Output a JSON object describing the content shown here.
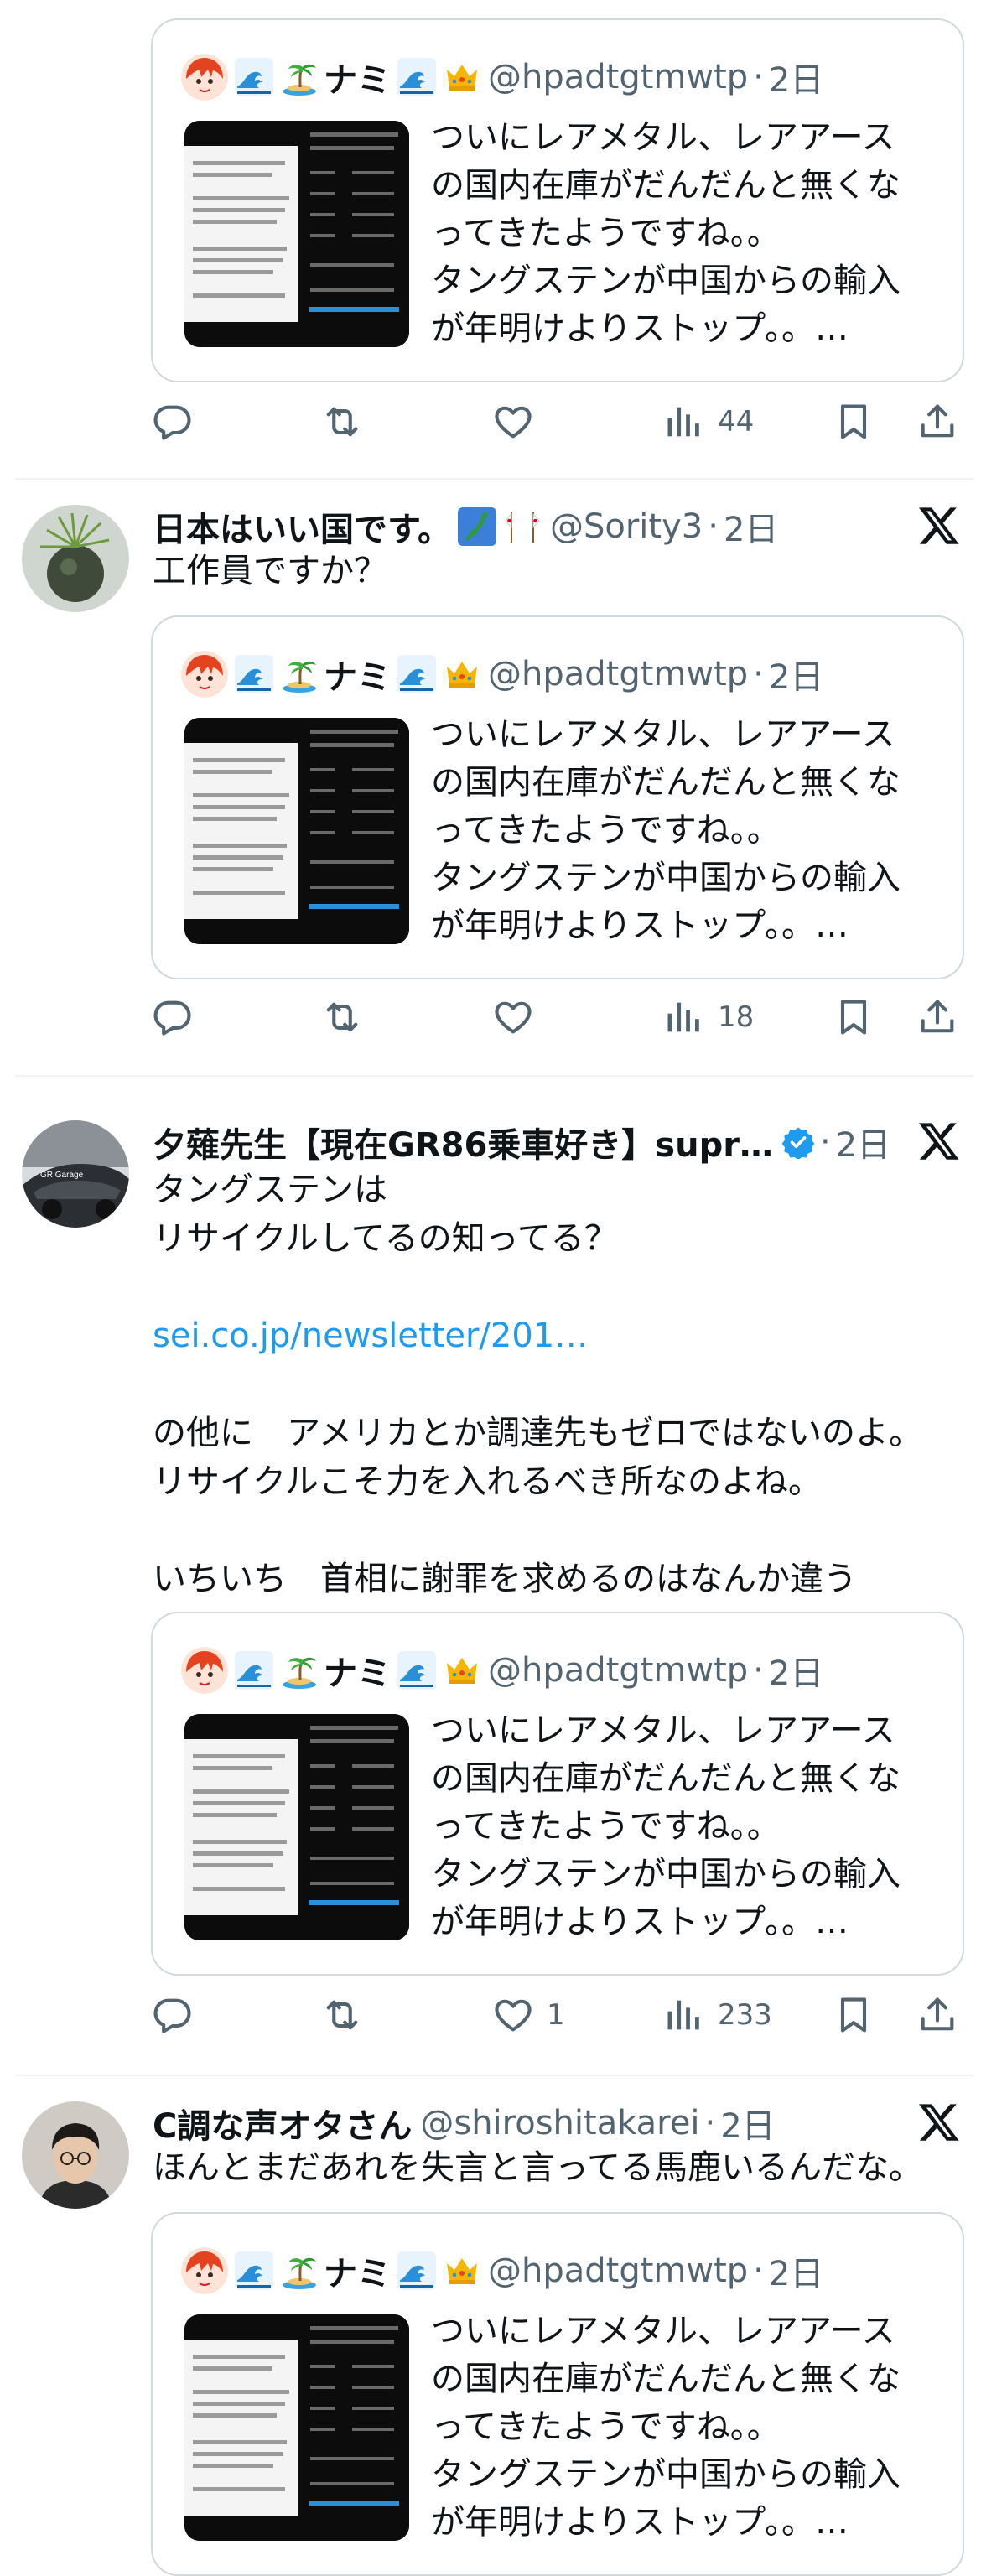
{
  "quoted_tweet": {
    "display_name": "ナミ",
    "handle": "@hpadtgtmwtp",
    "dot": "·",
    "time": "2日",
    "text": "ついにレアメタル、レアアース\nの国内在庫がだんだんと無くな\nってきたようですね。。\nタングステンが中国からの輸入\nが年明けよりストップ。。…"
  },
  "posts": [
    {
      "id": "post-0",
      "likes": "",
      "views": "44"
    },
    {
      "id": "post-1",
      "display_name": "日本はいい国です。",
      "handle": "@Sority3",
      "dot": "·",
      "time": "2日",
      "text": "工作員ですか？",
      "likes": "",
      "views": "18"
    },
    {
      "id": "post-2",
      "display_name": "夕薙先生【現在GR86乗車好き】supr…",
      "handle": "",
      "dot": "·",
      "time": "2日",
      "text_line1": "タングステンは\nリサイクルしてるの知ってる？",
      "link": "sei.co.jp/newsletter/201…",
      "text_line2": "の他に　アメリカとか調達先もゼロではないのよ。\nリサイクルこそ力を入れるべき所なのよね。\n\nいちいち　首相に謝罪を求めるのはなんか違う",
      "likes": "1",
      "views": "233"
    },
    {
      "id": "post-3",
      "display_name": "C調な声オタさん",
      "handle": "@shiroshitakarei",
      "dot": "·",
      "time": "2日",
      "text": "ほんとまだあれを失言と言ってる馬鹿いるんだな。"
    }
  ],
  "icons": {
    "reply": "reply-icon",
    "retweet": "retweet-icon",
    "like": "like-icon",
    "views": "views-icon",
    "bookmark": "bookmark-icon",
    "share": "share-icon",
    "x_logo": "x-logo-icon",
    "verified": "verified-badge-icon"
  },
  "colors": {
    "text": "#0f1419",
    "secondary": "#536471",
    "link": "#1d9bf0",
    "border": "#cfd9de"
  }
}
